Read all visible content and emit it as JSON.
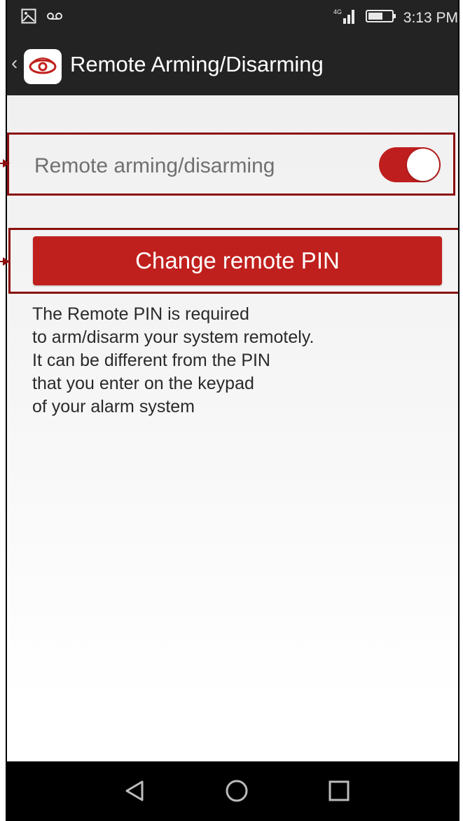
{
  "status_bar": {
    "time": "3:13 PM",
    "network": "4G",
    "icons": [
      "gallery-icon",
      "voicemail-icon",
      "signal-icon",
      "battery-icon"
    ]
  },
  "app_bar": {
    "title": "Remote Arming/Disarming",
    "logo": "eye-logo-icon"
  },
  "settings": {
    "toggle_label": "Remote arming/disarming",
    "toggle_on": true,
    "change_pin_label": "Change remote PIN",
    "info_lines": [
      "The Remote PIN is required",
      "to arm/disarm your system remotely.",
      "It can be different from the PIN",
      "that you enter on the keypad",
      "of your alarm system"
    ]
  },
  "nav_bar": {
    "buttons": [
      "back-icon",
      "home-icon",
      "recents-icon"
    ]
  },
  "colors": {
    "accent": "#c0201d",
    "highlight_border": "#8b0f0f",
    "bar": "#232323"
  }
}
